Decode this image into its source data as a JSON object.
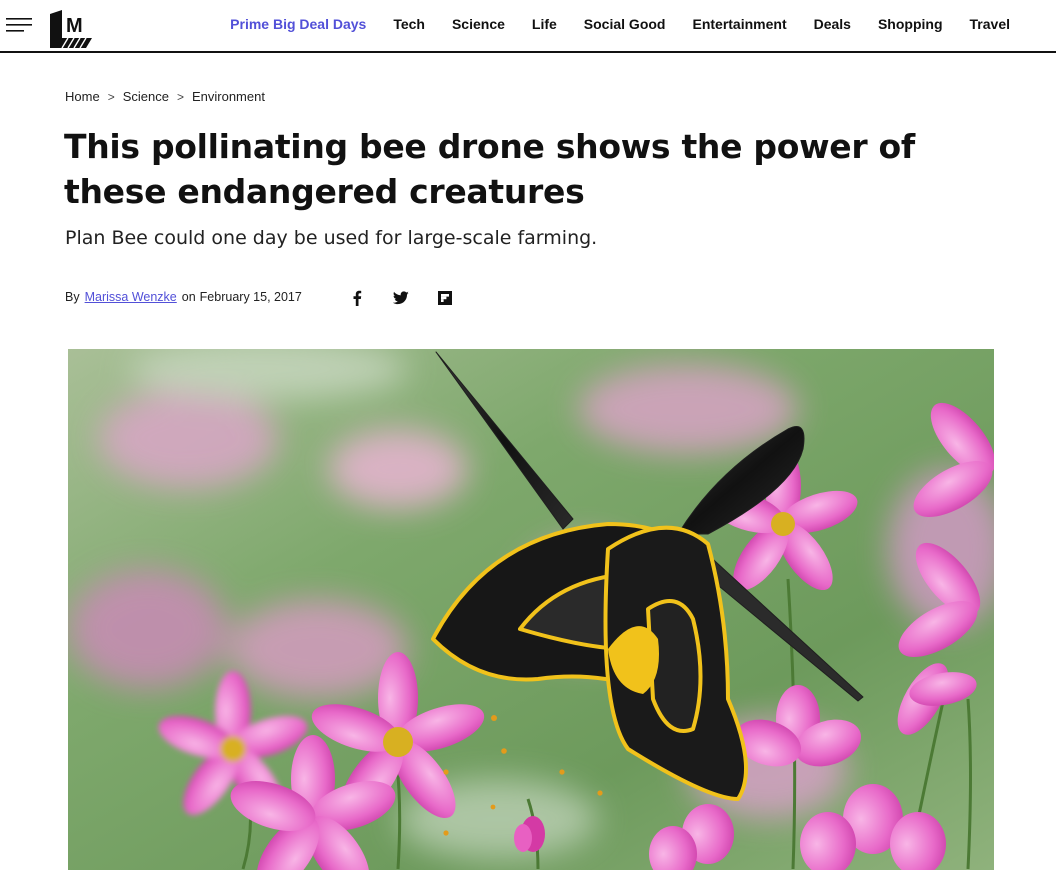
{
  "nav": {
    "links": [
      {
        "label": "Prime Big Deal Days",
        "active": true
      },
      {
        "label": "Tech"
      },
      {
        "label": "Science"
      },
      {
        "label": "Life"
      },
      {
        "label": "Social Good"
      },
      {
        "label": "Entertainment"
      },
      {
        "label": "Deals"
      },
      {
        "label": "Shopping"
      },
      {
        "label": "Travel"
      }
    ],
    "menu_icon": "hamburger-menu-icon",
    "logo_text": "M",
    "accent_color": "#5250d8"
  },
  "breadcrumb": {
    "items": [
      "Home",
      "Science",
      "Environment"
    ],
    "separator": ">"
  },
  "article": {
    "title": "This pollinating bee drone shows the power of these endangered creatures",
    "subtitle": "Plan Bee could one day be used for large-scale farming.",
    "byline_prefix": "By",
    "author": "Marissa Wenzke",
    "date_prefix": "on",
    "date": "February 15, 2017"
  },
  "share": {
    "icons": [
      "facebook-icon",
      "twitter-icon",
      "flipboard-icon"
    ]
  }
}
